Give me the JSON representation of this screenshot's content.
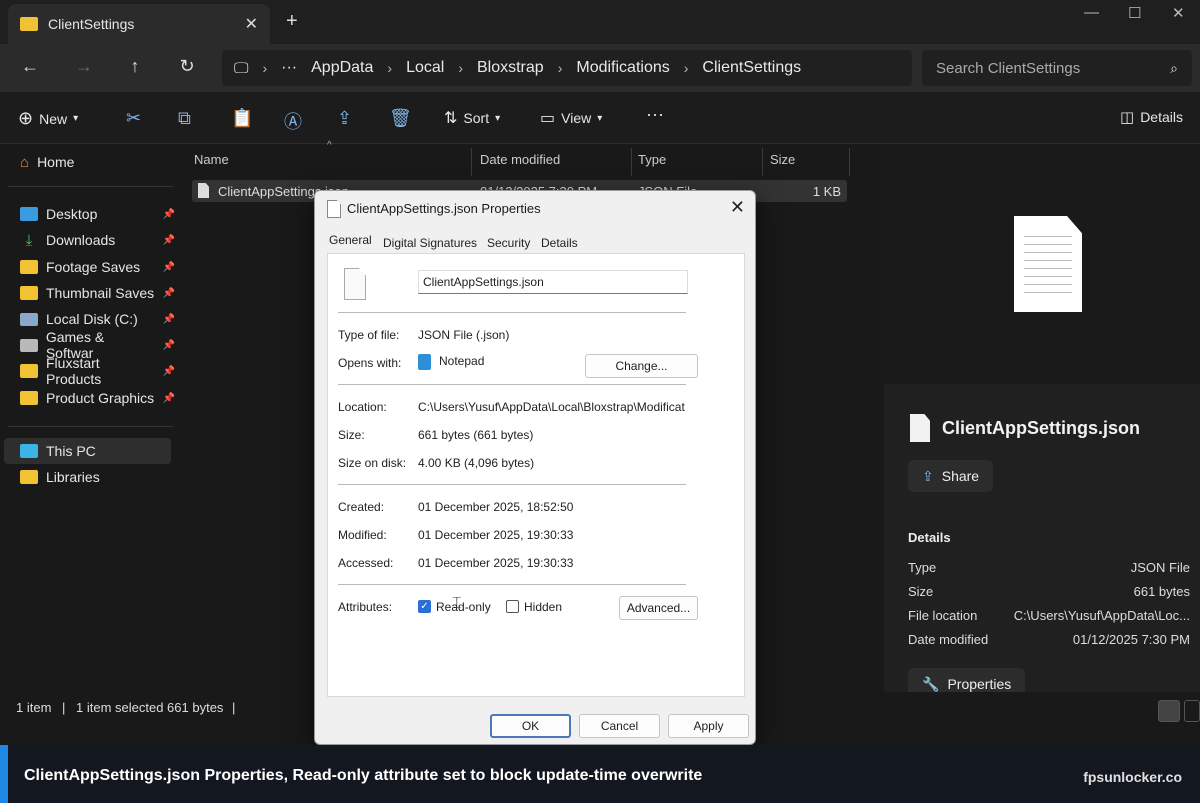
{
  "window": {
    "tab_title": "ClientSettings",
    "tab_close": "✕",
    "new_tab": "+",
    "controls": [
      "—",
      "☐",
      "✕"
    ]
  },
  "nav": {
    "back": "←",
    "forward": "→",
    "up": "↑",
    "refresh": "↻",
    "breadcrumb": [
      "AppData",
      "Local",
      "Bloxstrap",
      "Modifications",
      "ClientSettings"
    ],
    "more": "···",
    "search_placeholder": "Search ClientSettings"
  },
  "toolbar": {
    "new_label": "New",
    "sort_label": "Sort",
    "view_label": "View",
    "more": "···",
    "details_label": "Details"
  },
  "sidebar": {
    "home": "Home",
    "quick": [
      {
        "label": "Desktop",
        "icon": "desktop-icon"
      },
      {
        "label": "Downloads",
        "icon": "download-icon"
      },
      {
        "label": "Footage Saves",
        "icon": "folder-icon"
      },
      {
        "label": "Thumbnail Saves",
        "icon": "folder-icon"
      },
      {
        "label": "Local Disk (C:)",
        "icon": "drive-icon"
      },
      {
        "label": "Games & Softwar",
        "icon": "drive-icon"
      },
      {
        "label": "Fluxstart Products",
        "icon": "folder-icon"
      },
      {
        "label": "Product Graphics",
        "icon": "folder-icon"
      }
    ],
    "this_pc": "This PC",
    "libraries": "Libraries"
  },
  "filelist": {
    "columns": {
      "name": "Name",
      "date": "Date modified",
      "type": "Type",
      "size": "Size"
    },
    "rows": [
      {
        "name": "ClientAppSettings.json",
        "date": "01/12/2025 7:30 PM",
        "type": "JSON File",
        "size": "1 KB"
      }
    ]
  },
  "details": {
    "file_name": "ClientAppSettings.json",
    "share_label": "Share",
    "section_title": "Details",
    "rows": [
      {
        "key": "Type",
        "value": "JSON File"
      },
      {
        "key": "Size",
        "value": "661 bytes"
      },
      {
        "key": "File location",
        "value": "C:\\Users\\Yusuf\\AppData\\Loc..."
      },
      {
        "key": "Date modified",
        "value": "01/12/2025 7:30 PM"
      }
    ],
    "properties_label": "Properties"
  },
  "status": {
    "count": "1 item",
    "selected": "1 item selected  661 bytes"
  },
  "dialog": {
    "title": "ClientAppSettings.json Properties",
    "close": "✕",
    "tabs": [
      "General",
      "Digital Signatures",
      "Security",
      "Details"
    ],
    "file_name": "ClientAppSettings.json",
    "type_label": "Type of file:",
    "type_value": "JSON File (.json)",
    "opens_label": "Opens with:",
    "opens_value": "Notepad",
    "change_label": "Change...",
    "location_label": "Location:",
    "location_value": "C:\\Users\\Yusuf\\AppData\\Local\\Bloxstrap\\Modificat",
    "size_label": "Size:",
    "size_value": "661 bytes (661 bytes)",
    "sod_label": "Size on disk:",
    "sod_value": "4.00 KB (4,096 bytes)",
    "created_label": "Created:",
    "created_value": "01 December 2025, 18:52:50",
    "modified_label": "Modified:",
    "modified_value": "01 December 2025, 19:30:33",
    "accessed_label": "Accessed:",
    "accessed_value": "01 December 2025, 19:30:33",
    "attributes_label": "Attributes:",
    "readonly_label": "Read-only",
    "readonly_checked": true,
    "hidden_label": "Hidden",
    "hidden_checked": false,
    "advanced_label": "Advanced...",
    "ok_label": "OK",
    "cancel_label": "Cancel",
    "apply_label": "Apply"
  },
  "caption": {
    "text": "ClientAppSettings.json Properties, Read-only attribute set to block update-time overwrite",
    "brand": "fpsunlocker.co"
  },
  "colors": {
    "accent": "#1e88e5",
    "folder": "#f1c232",
    "checkbox": "#2a6fd6"
  }
}
